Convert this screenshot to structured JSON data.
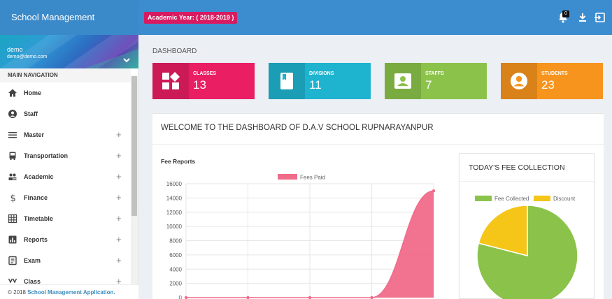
{
  "app": {
    "title": "School Management Application"
  },
  "header": {
    "academic_year": "Academic Year: ( 2018-2019 )",
    "notification_count": "0"
  },
  "user": {
    "name": "demo",
    "email": "demo@demo.com"
  },
  "sidebar": {
    "nav_header": "MAIN NAVIGATION",
    "items": [
      {
        "label": "Home",
        "icon": "home-icon",
        "expandable": false
      },
      {
        "label": "Staff",
        "icon": "user-circle-icon",
        "expandable": false
      },
      {
        "label": "Master",
        "icon": "menu-icon",
        "expandable": true
      },
      {
        "label": "Transportation",
        "icon": "bus-icon",
        "expandable": true
      },
      {
        "label": "Academic",
        "icon": "people-icon",
        "expandable": true
      },
      {
        "label": "Finance",
        "icon": "dollar-icon",
        "expandable": true
      },
      {
        "label": "Timetable",
        "icon": "grid-icon",
        "expandable": true
      },
      {
        "label": "Reports",
        "icon": "bar-chart-icon",
        "expandable": true
      },
      {
        "label": "Exam",
        "icon": "document-icon",
        "expandable": true
      },
      {
        "label": "Class",
        "icon": "class-icon",
        "expandable": true
      }
    ],
    "expand_symbol": "+"
  },
  "footer": {
    "prefix": "© 2018 ",
    "link": "School Management Application."
  },
  "main": {
    "heading": "DASHBOARD",
    "info_boxes": [
      {
        "label": "CLASSES",
        "value": "13",
        "color": "#e91e63",
        "icon": "classes-icon"
      },
      {
        "label": "DIVISIONS",
        "value": "11",
        "color": "#1eb3cf",
        "icon": "book-icon"
      },
      {
        "label": "STAFFS",
        "value": "7",
        "color": "#8bc34a",
        "icon": "contact-icon"
      },
      {
        "label": "STUDENTS",
        "value": "23",
        "color": "#f7941d",
        "icon": "account-circle-icon"
      }
    ],
    "welcome_title": "WELCOME TO THE DASHBOARD OF D.A.V SCHOOL RUPNARAYANPUR"
  },
  "fee_report": {
    "title": "Fee Reports",
    "chart_data": {
      "type": "area",
      "series": [
        {
          "name": "Fees Paid",
          "values": [
            0,
            0,
            0,
            0,
            15000
          ],
          "color": "#f06b8a"
        }
      ],
      "ylim": [
        0,
        16000
      ],
      "yticks": [
        0,
        2000,
        4000,
        6000,
        8000,
        10000,
        12000,
        14000,
        16000
      ],
      "grid": true,
      "legend": "top"
    }
  },
  "fee_collection": {
    "title": "TODAY'S FEE COLLECTION",
    "chart_data": {
      "type": "pie",
      "labels": [
        "Fee Collected",
        "Discount"
      ],
      "values": [
        79,
        21
      ],
      "colors": [
        "#8bc34a",
        "#f5c518"
      ],
      "legend": "top"
    }
  }
}
